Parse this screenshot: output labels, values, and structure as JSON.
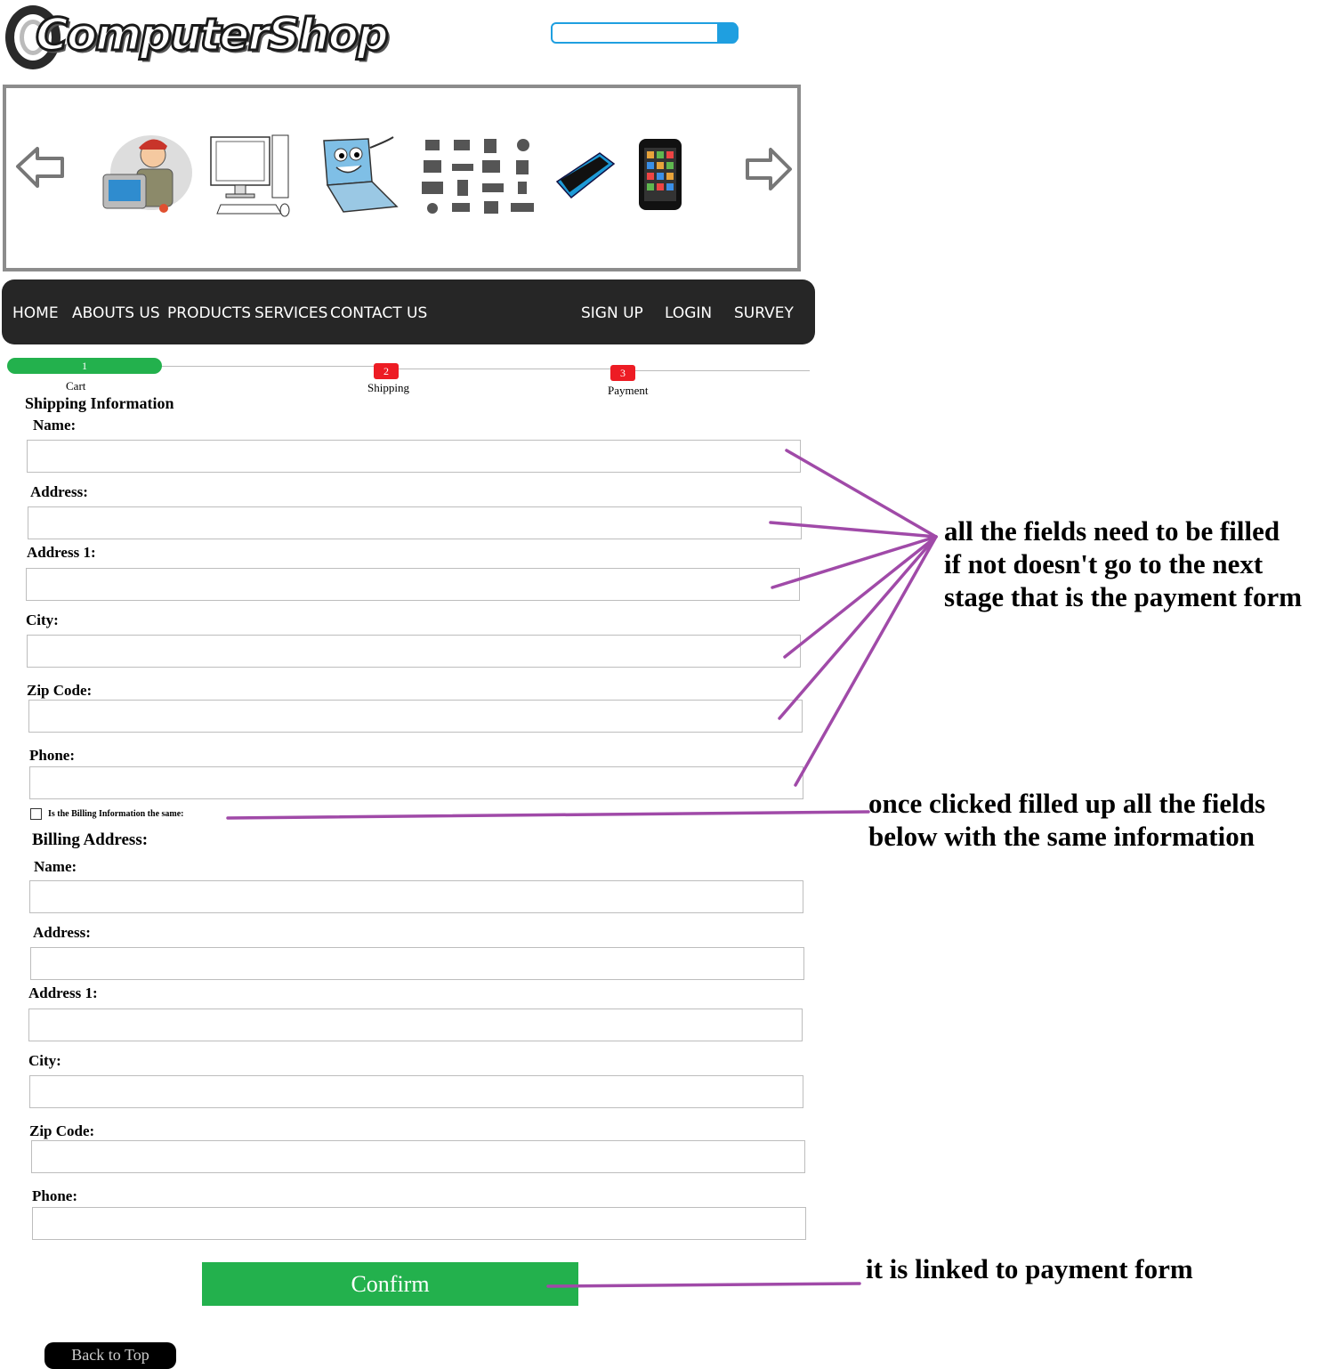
{
  "header": {
    "logo_text": "ComputerShop",
    "search": {
      "placeholder": "",
      "value": ""
    }
  },
  "nav": {
    "left_items": [
      "HOME",
      "ABOUTS US",
      "PRODUCTS",
      "SERVICES",
      "CONTACT US"
    ],
    "right_items": [
      "SIGN UP",
      "LOGIN",
      "SURVEY"
    ]
  },
  "steps": [
    {
      "number": "1",
      "label": "Cart",
      "color": "#23b14d"
    },
    {
      "number": "2",
      "label": "Shipping",
      "color": "#ed1c24"
    },
    {
      "number": "3",
      "label": "Payment",
      "color": "#ed1c24"
    }
  ],
  "shipping": {
    "title": "Shipping Information",
    "fields": {
      "name": "Name:",
      "address": "Address:",
      "address1": "Address 1:",
      "city": "City:",
      "zip": "Zip Code:",
      "phone": "Phone:"
    }
  },
  "same_billing_label": "Is the Billing Information the same:",
  "billing": {
    "title": "Billing Address:",
    "fields": {
      "name": "Name:",
      "address": "Address:",
      "address1": "Address 1:",
      "city": "City:",
      "zip": "Zip Code:",
      "phone": "Phone:"
    }
  },
  "confirm_label": "Confirm",
  "back_to_top_label": "Back to Top",
  "annotations": {
    "fields_required": [
      "all the fields need to be filled",
      "if not doesn't go to the next",
      "stage that is the payment form"
    ],
    "checkbox_note": [
      "once clicked filled up all the fields",
      "below with the same information"
    ],
    "confirm_note": "it is linked to payment form"
  },
  "colors": {
    "nav_bg": "#262626",
    "accent_green": "#23b14d",
    "step_red": "#ed1c24",
    "search_blue": "#1f9fe0",
    "annotation_purple": "#a04aa8"
  },
  "icons": [
    "left-arrow-icon",
    "right-arrow-icon",
    "search-icon"
  ]
}
